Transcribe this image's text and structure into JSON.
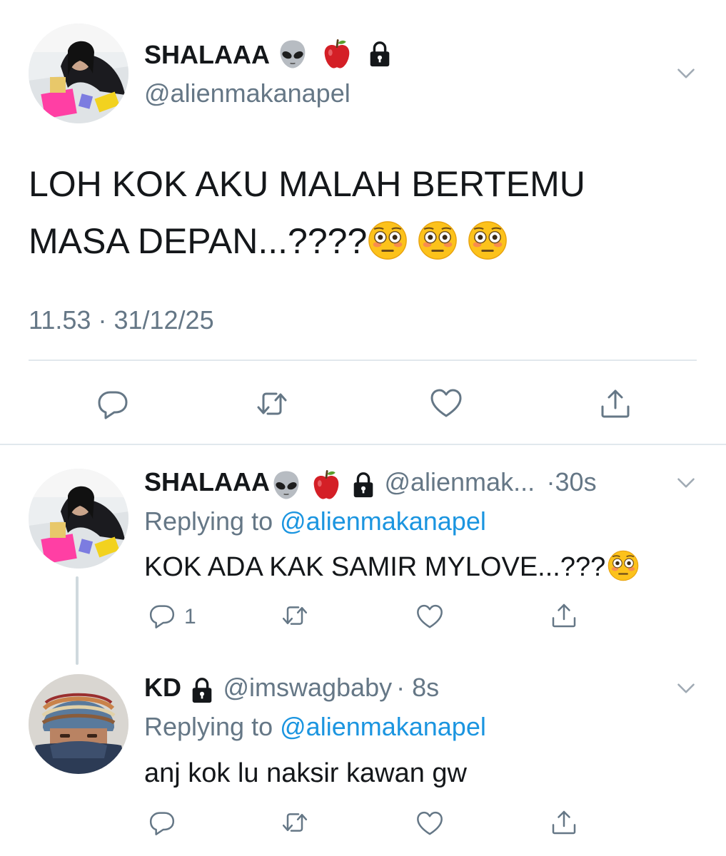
{
  "main_tweet": {
    "display_name": "SHALAAA",
    "badges": [
      "alien-emoji",
      "apple-emoji",
      "lock-icon"
    ],
    "handle": "@alienmakanapel",
    "text_line1": "LOH KOK AKU MALAH BERTEMU",
    "text_line2": "MASA DEPAN...????",
    "trailing_emojis": [
      "flushed-emoji",
      "flushed-emoji",
      "flushed-emoji"
    ],
    "time": "11.53",
    "separator": "·",
    "date": "31/12/25"
  },
  "action_icons": [
    "reply-icon",
    "retweet-icon",
    "like-icon",
    "share-icon"
  ],
  "reply1": {
    "display_name": "SHALAAA",
    "handle": "@alienmak...",
    "time": "·30s",
    "replying_prefix": "Replying to",
    "replying_to": "@alienmakanapel",
    "text": "KOK ADA KAK SAMIR MYLOVE...???",
    "reply_count": "1"
  },
  "reply2": {
    "display_name": "KD",
    "handle": "@imswagbaby",
    "time": "· 8s",
    "replying_prefix": "Replying to",
    "replying_to": "@alienmakanapel",
    "text": "anj kok lu naksir kawan gw"
  },
  "colors": {
    "text": "#14171a",
    "secondary": "#657786",
    "link": "#1b95e0",
    "divider": "#e1e8ed"
  }
}
